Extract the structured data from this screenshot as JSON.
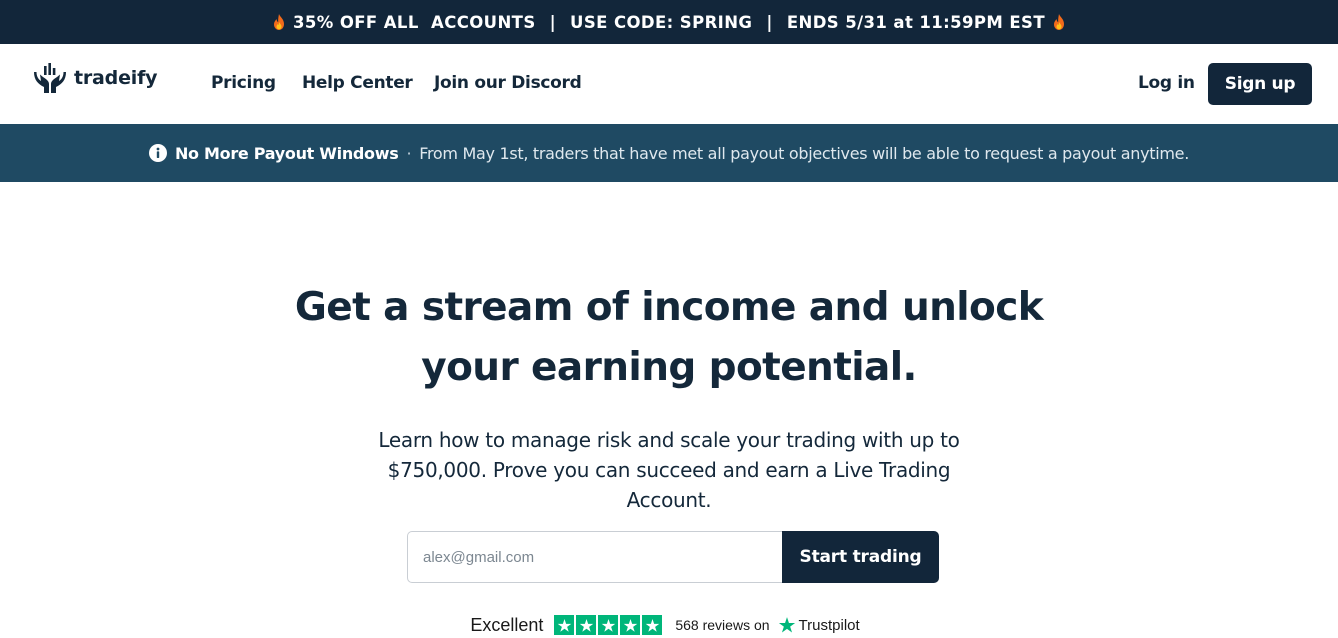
{
  "promo_bar": {
    "offer": "35% OFF ALL  ACCOUNTS",
    "separator": "|",
    "code": "USE CODE: SPRING",
    "ends": "ENDS 5/31 at 11:59PM EST",
    "icon": "fire-icon"
  },
  "nav": {
    "brand": "tradeify",
    "links": [
      "Pricing",
      "Help Center",
      "Join our Discord"
    ],
    "login": "Log in",
    "signup": "Sign up"
  },
  "notice": {
    "icon": "info-icon",
    "title": "No More Payout Windows",
    "separator": "·",
    "message": "From May 1st, traders that have met all payout objectives will be able to request a payout anytime."
  },
  "hero": {
    "headline_line1": "Get a stream of income and unlock",
    "headline_line2": "your earning potential.",
    "subtext": "Learn how to manage risk and scale your trading with up to $750,000. Prove you can succeed and earn a Live Trading Account.",
    "email_placeholder": "alex@gmail.com",
    "cta": "Start trading"
  },
  "trustpilot": {
    "rating_text": "Excellent",
    "stars": 5,
    "reviews": "568 reviews on",
    "brand": "Trustpilot"
  },
  "colors": {
    "navy": "#12263a",
    "notice_bg": "#1f4a63",
    "trustpilot_green": "#00b67a",
    "fire_orange": "#f26a1b"
  }
}
